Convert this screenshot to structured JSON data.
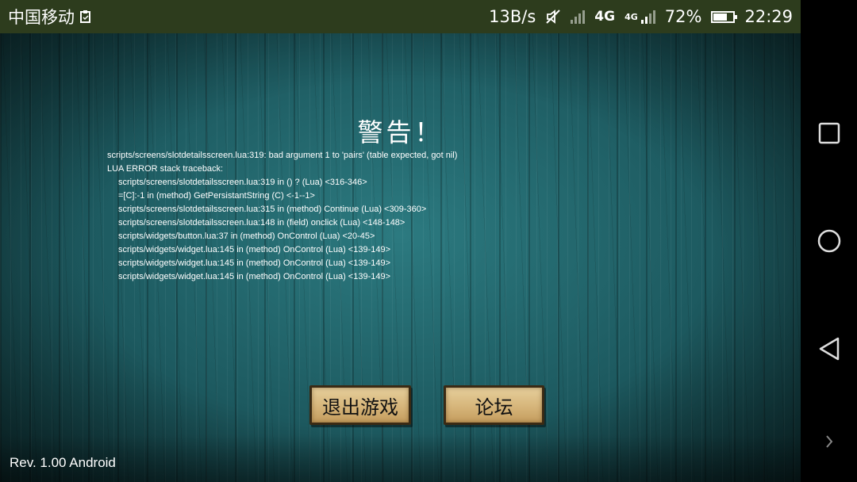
{
  "status_bar": {
    "carrier": "中国移动",
    "network_speed": "13B/s",
    "network_type_1": "4G",
    "network_type_2": "4G",
    "battery_percent": "72%",
    "battery_level": 0.72,
    "time": "22:29"
  },
  "dialog": {
    "title": "警告！",
    "error_lines": [
      "scripts/screens/slotdetailsscreen.lua:319: bad argument 1 to 'pairs' (table expected, got nil)",
      "LUA ERROR stack traceback:",
      "scripts/screens/slotdetailsscreen.lua:319 in () ? (Lua) <316-346>",
      "=[C]:-1 in (method) GetPersistantString (C) <-1--1>",
      "scripts/screens/slotdetailsscreen.lua:315 in (method) Continue (Lua) <309-360>",
      "scripts/screens/slotdetailsscreen.lua:148 in (field) onclick (Lua) <148-148>",
      "scripts/widgets/button.lua:37 in (method) OnControl (Lua) <20-45>",
      "scripts/widgets/widget.lua:145 in (method) OnControl (Lua) <139-149>",
      "scripts/widgets/widget.lua:145 in (method) OnControl (Lua) <139-149>",
      "scripts/widgets/widget.lua:145 in (method) OnControl (Lua) <139-149>"
    ],
    "buttons": {
      "quit_label": "退出游戏",
      "forum_label": "论坛"
    }
  },
  "footer": {
    "revision": "Rev. 1.00 Android"
  },
  "nav_bar": {
    "items": [
      "recent-apps-icon",
      "home-icon",
      "back-icon",
      "chevron-right-icon"
    ]
  },
  "colors": {
    "status_bar_bg": "#2d3c1d",
    "background_teal": "#1d5a60",
    "button_wood": "#d6b57a"
  }
}
